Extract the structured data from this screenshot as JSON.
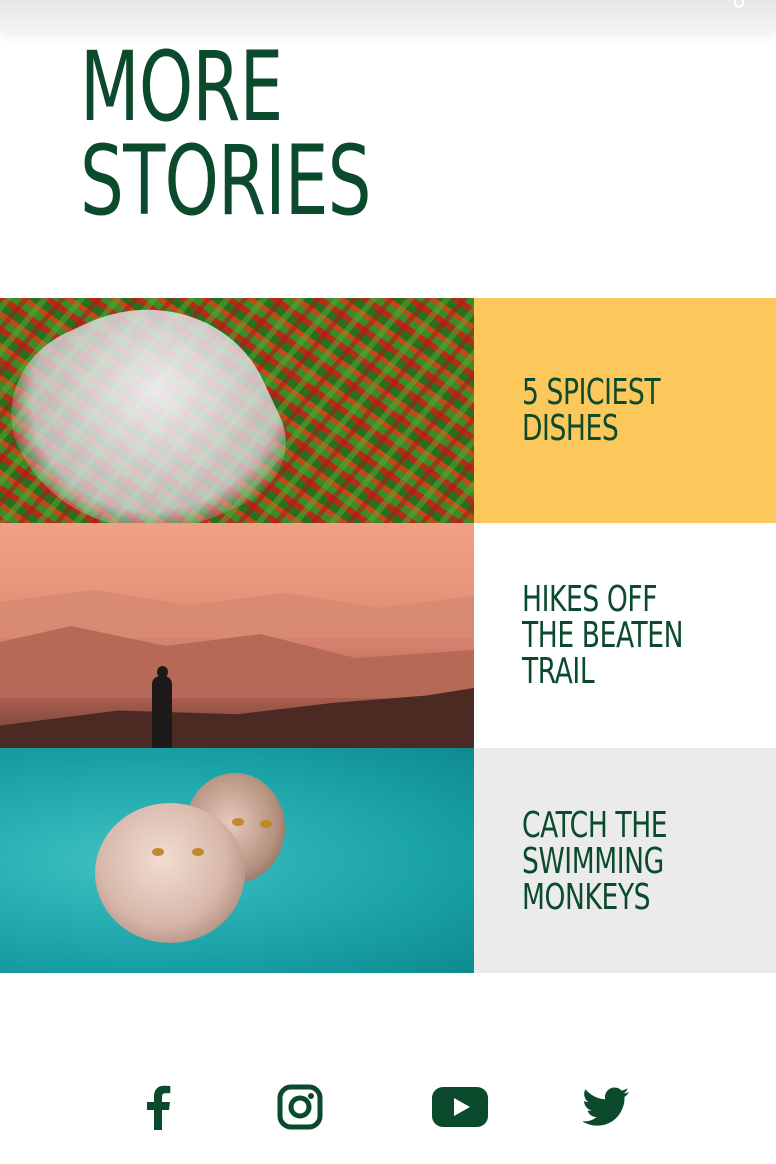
{
  "section": {
    "heading_line1": "MORE",
    "heading_line2": "STORIES"
  },
  "stories": [
    {
      "title_lines": [
        "5 SPICIEST",
        "DISHES"
      ],
      "panel_color": "#fcc75b",
      "image": "chili-peppers-image"
    },
    {
      "title_lines": [
        "HIKES OFF",
        "THE BEATEN",
        "TRAIL"
      ],
      "panel_color": "#ffffff",
      "image": "mountain-hiker-image"
    },
    {
      "title_lines": [
        "CATCH THE",
        "SWIMMING",
        "MONKEYS"
      ],
      "panel_color": "#ebebeb",
      "image": "swimming-monkeys-image"
    }
  ],
  "social": [
    {
      "icon": "facebook-icon"
    },
    {
      "icon": "instagram-icon"
    },
    {
      "icon": "youtube-icon"
    },
    {
      "icon": "twitter-icon"
    }
  ],
  "colors": {
    "accent_green": "#0b4a2c",
    "yellow": "#fcc75b",
    "light_gray": "#ebebeb"
  }
}
